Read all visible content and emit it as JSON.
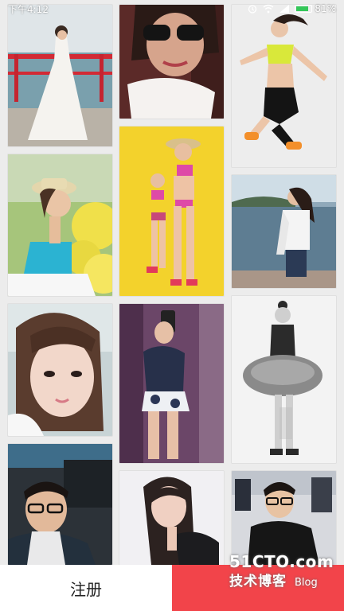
{
  "status_bar": {
    "time": "下午4:12",
    "battery": "81%",
    "battery_level": 0.81,
    "icons": [
      "alarm-icon",
      "wifi-icon",
      "signal-icon",
      "battery-icon"
    ]
  },
  "photos": [
    {
      "name": "photo-wedding-dress",
      "column": 1,
      "subject": "bride in white dress by red railing"
    },
    {
      "name": "photo-sunglasses-selfie",
      "column": 2,
      "subject": "woman in sunglasses"
    },
    {
      "name": "photo-jumping-fitness",
      "column": 3,
      "subject": "jumping woman in yellow top"
    },
    {
      "name": "photo-straw-hat-flowers",
      "column": 1,
      "subject": "woman in straw hat among yellow flowers"
    },
    {
      "name": "photo-two-girls-yellow",
      "column": 2,
      "subject": "two girls in swimwear on yellow background"
    },
    {
      "name": "photo-lakeside-scarf",
      "column": 3,
      "subject": "woman at lakeside"
    },
    {
      "name": "photo-closeup-portrait",
      "column": 1,
      "subject": "close-up portrait"
    },
    {
      "name": "photo-mirror-selfie",
      "column": 2,
      "subject": "mirror selfie in floral skirt"
    },
    {
      "name": "photo-bw-tutu",
      "column": 3,
      "subject": "black and white woman in tutu"
    },
    {
      "name": "photo-man-in-car",
      "column": 1,
      "subject": "man with glasses in car"
    },
    {
      "name": "photo-woman-long-hair",
      "column": 2,
      "subject": "woman with long hair"
    },
    {
      "name": "photo-man-gym",
      "column": 3,
      "subject": "man with glasses in gym"
    }
  ],
  "actions": {
    "register_label": "注册",
    "login_label": ""
  },
  "watermark": {
    "site": "51CTO.com",
    "cn": "技术博客",
    "blog": "Blog"
  },
  "colors": {
    "background": "#ececec",
    "login_button": "#f2444a",
    "register_button": "#ffffff"
  }
}
